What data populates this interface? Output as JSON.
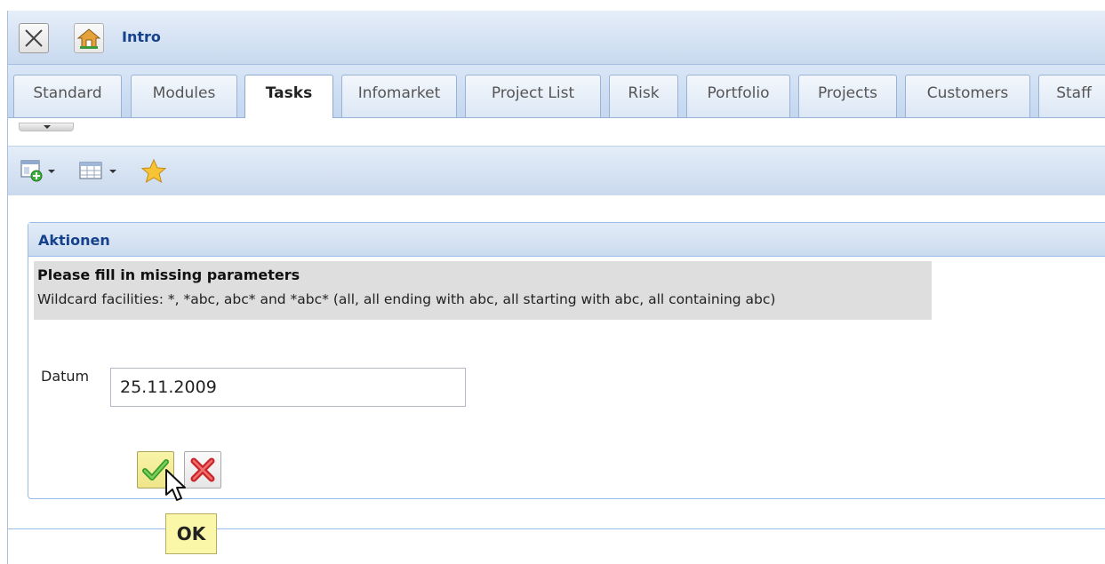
{
  "window": {
    "title": "Intro"
  },
  "tabs": [
    {
      "label": "Standard",
      "active": false
    },
    {
      "label": "Modules",
      "active": false
    },
    {
      "label": "Tasks",
      "active": true
    },
    {
      "label": "Infomarket",
      "active": false
    },
    {
      "label": "Project List",
      "active": false
    },
    {
      "label": "Risk",
      "active": false
    },
    {
      "label": "Portfolio",
      "active": false
    },
    {
      "label": "Projects",
      "active": false
    },
    {
      "label": "Customers",
      "active": false
    },
    {
      "label": "Staff",
      "active": false
    }
  ],
  "toolbar": {
    "icons": [
      "add-layout-icon",
      "table-view-icon",
      "favorite-star-icon"
    ]
  },
  "panel": {
    "title": "Aktionen",
    "notice_title": "Please fill in missing parameters",
    "notice_text": "Wildcard facilities: *, *abc, abc* and *abc* (all, all ending with abc, all starting with abc, all containing abc)",
    "field_label": "Datum",
    "field_value": "25.11.2009"
  },
  "tooltip": {
    "text": "OK"
  },
  "colors": {
    "accent_text": "#15428b",
    "header_gradient_top": "#e3ecf8",
    "header_gradient_bottom": "#cbdbef",
    "tooltip_bg": "#fbf7a9",
    "notice_bg": "#dedede"
  }
}
